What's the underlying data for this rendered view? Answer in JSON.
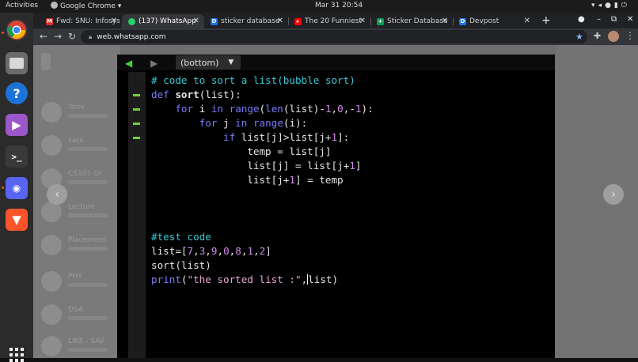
{
  "system": {
    "activities": "Activities",
    "app_menu": "Google Chrome",
    "clock": "Mar 31  20:54"
  },
  "tabs": [
    {
      "label": "Fwd: SNU: Infosys",
      "favicon": "gmail-icon",
      "color": "#d93025"
    },
    {
      "label": "(137) WhatsApp",
      "favicon": "whatsapp-icon",
      "color": "#25d366"
    },
    {
      "label": "sticker database",
      "favicon": "devpost-icon",
      "color": "#1a73e8"
    },
    {
      "label": "The 20 Funniest",
      "favicon": "youtube-icon",
      "color": "#ff0000"
    },
    {
      "label": "Sticker Database",
      "favicon": "sheets-icon",
      "color": "#0f9d58"
    },
    {
      "label": "Devpost",
      "favicon": "devpost-icon",
      "color": "#1a73e8"
    }
  ],
  "address": {
    "url": "web.whatsapp.com"
  },
  "whatsapp": {
    "chats": [
      "Tony",
      "sara",
      "CS101 Gr",
      "Lecture",
      "Placement",
      "PHY",
      "DSA",
      "LIKE - SAV"
    ]
  },
  "editor": {
    "dropdown": "(bottom)",
    "lines": [
      [
        {
          "t": "# code to sort a list(bubble sort)",
          "c": "cm"
        }
      ],
      [
        {
          "t": "def ",
          "c": "kw"
        },
        {
          "t": "sort",
          "c": "fn"
        },
        {
          "t": "(list):",
          "c": ""
        }
      ],
      [
        {
          "t": "    ",
          "c": ""
        },
        {
          "t": "for",
          "c": "kw"
        },
        {
          "t": " i ",
          "c": ""
        },
        {
          "t": "in",
          "c": "kw"
        },
        {
          "t": " ",
          "c": ""
        },
        {
          "t": "range",
          "c": "kw"
        },
        {
          "t": "(",
          "c": ""
        },
        {
          "t": "len",
          "c": "kw"
        },
        {
          "t": "(list)-",
          "c": ""
        },
        {
          "t": "1",
          "c": "nm"
        },
        {
          "t": ",",
          "c": ""
        },
        {
          "t": "0",
          "c": "nm"
        },
        {
          "t": ",-",
          "c": ""
        },
        {
          "t": "1",
          "c": "nm"
        },
        {
          "t": "):",
          "c": ""
        }
      ],
      [
        {
          "t": "        ",
          "c": ""
        },
        {
          "t": "for",
          "c": "kw"
        },
        {
          "t": " j ",
          "c": ""
        },
        {
          "t": "in",
          "c": "kw"
        },
        {
          "t": " ",
          "c": ""
        },
        {
          "t": "range",
          "c": "kw"
        },
        {
          "t": "(i):",
          "c": ""
        }
      ],
      [
        {
          "t": "            ",
          "c": ""
        },
        {
          "t": "if",
          "c": "kw"
        },
        {
          "t": " list[j]>list[j+",
          "c": ""
        },
        {
          "t": "1",
          "c": "nm"
        },
        {
          "t": "]:",
          "c": ""
        }
      ],
      [
        {
          "t": "                temp = list[j]",
          "c": ""
        }
      ],
      [
        {
          "t": "                list[j] = list[j+",
          "c": ""
        },
        {
          "t": "1",
          "c": "nm"
        },
        {
          "t": "]",
          "c": ""
        }
      ],
      [
        {
          "t": "                list[j+",
          "c": ""
        },
        {
          "t": "1",
          "c": "nm"
        },
        {
          "t": "] = temp",
          "c": ""
        }
      ],
      [],
      [],
      [],
      [
        {
          "t": "#test code",
          "c": "cm"
        }
      ],
      [
        {
          "t": "list=[",
          "c": ""
        },
        {
          "t": "7",
          "c": "nm"
        },
        {
          "t": ",",
          "c": ""
        },
        {
          "t": "3",
          "c": "nm"
        },
        {
          "t": ",",
          "c": ""
        },
        {
          "t": "9",
          "c": "nm"
        },
        {
          "t": ",",
          "c": ""
        },
        {
          "t": "0",
          "c": "nm"
        },
        {
          "t": ",",
          "c": ""
        },
        {
          "t": "8",
          "c": "nm"
        },
        {
          "t": ",",
          "c": ""
        },
        {
          "t": "1",
          "c": "nm"
        },
        {
          "t": ",",
          "c": ""
        },
        {
          "t": "2",
          "c": "nm"
        },
        {
          "t": "]",
          "c": ""
        }
      ],
      [
        {
          "t": "sort(list)",
          "c": ""
        }
      ],
      [
        {
          "t": "print",
          "c": "kw"
        },
        {
          "t": "(",
          "c": ""
        },
        {
          "t": "\"the sorted list :\"",
          "c": "st"
        },
        {
          "t": ",",
          "c": ""
        },
        {
          "t": "|",
          "c": "cursor"
        },
        {
          "t": "list)",
          "c": ""
        }
      ]
    ]
  },
  "colors": {
    "comment": "#39c8d4",
    "keyword": "#7b7cf7",
    "number": "#d08be8",
    "string": "#e7a3d6",
    "gutter_mark": "#6fd03d"
  }
}
